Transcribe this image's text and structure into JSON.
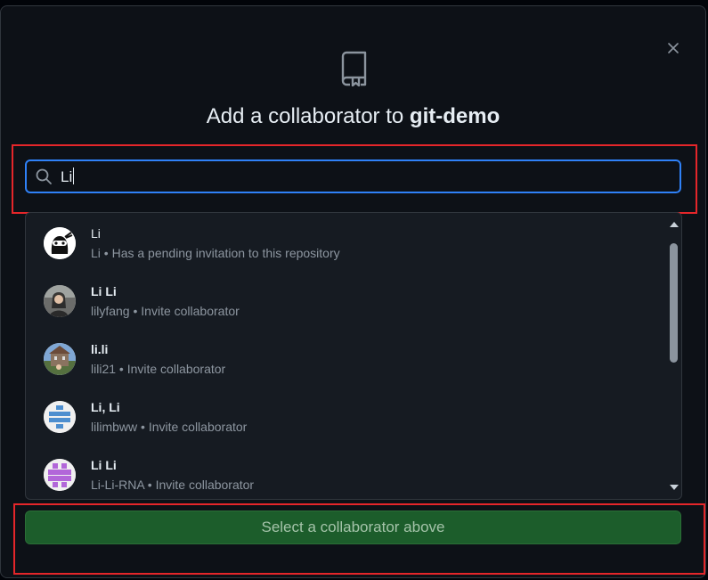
{
  "dialog": {
    "title_prefix": "Add a collaborator to",
    "repo_name": "git-demo",
    "close_icon": "close-icon",
    "repo_icon": "repo-icon"
  },
  "search": {
    "value": "Li",
    "icon": "search-icon"
  },
  "results": [
    {
      "name": "Li",
      "login": "Li",
      "status": "Has a pending invitation to this repository",
      "bold": false
    },
    {
      "name": "Li Li",
      "login": "lilyfang",
      "status": "Invite collaborator",
      "bold": true
    },
    {
      "name": "li.li",
      "login": "lili21",
      "status": "Invite collaborator",
      "bold": true
    },
    {
      "name": "Li, Li",
      "login": "lilimbww",
      "status": "Invite collaborator",
      "bold": true
    },
    {
      "name": "Li Li",
      "login": "Li-Li-RNA",
      "status": "Invite collaborator",
      "bold": true
    }
  ],
  "action": {
    "label": "Select a collaborator above"
  },
  "colors": {
    "accent": "#2f81f7",
    "highlight": "#e5262a",
    "button_bg": "#1c5d2b"
  }
}
